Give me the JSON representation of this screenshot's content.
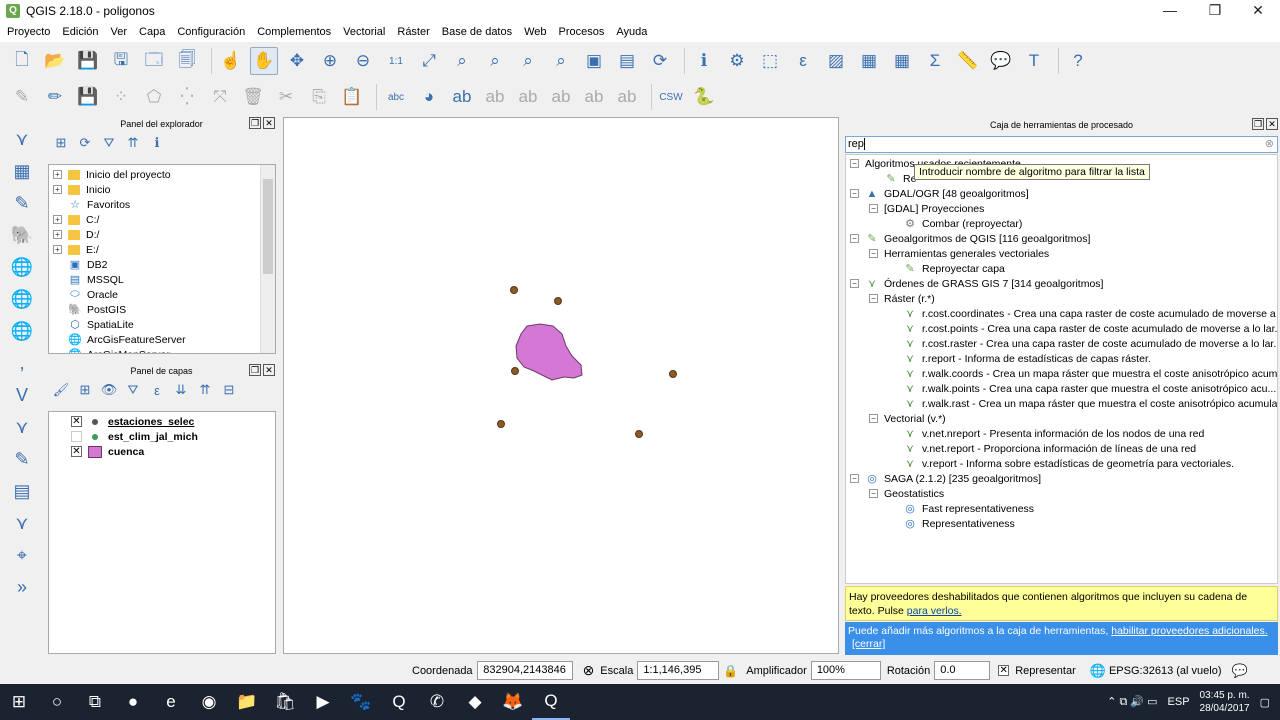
{
  "window": {
    "title": "QGIS 2.18.0 - poligonos",
    "icon": "qgis-icon",
    "minimize": "—",
    "maximize": "❐",
    "close": "✕"
  },
  "menu": [
    "Proyecto",
    "Edición",
    "Ver",
    "Capa",
    "Configuración",
    "Complementos",
    "Vectorial",
    "Ráster",
    "Base de datos",
    "Web",
    "Procesos",
    "Ayuda"
  ],
  "toolbar1": [
    {
      "name": "new-project-icon",
      "glyph": "🗋"
    },
    {
      "name": "open-project-icon",
      "glyph": "📂"
    },
    {
      "name": "save-project-icon",
      "glyph": "💾"
    },
    {
      "name": "save-as-icon",
      "glyph": "🖫"
    },
    {
      "name": "new-print-composer-icon",
      "glyph": "🗔"
    },
    {
      "name": "composer-manager-icon",
      "glyph": "🗐"
    },
    {
      "name": "sep"
    },
    {
      "name": "touch-zoom-icon",
      "glyph": "☝"
    },
    {
      "name": "pan-icon",
      "glyph": "✋",
      "active": true
    },
    {
      "name": "pan-to-selection-icon",
      "glyph": "✥"
    },
    {
      "name": "zoom-in-icon",
      "glyph": "⊕"
    },
    {
      "name": "zoom-out-icon",
      "glyph": "⊖"
    },
    {
      "name": "zoom-native-icon",
      "glyph": "1:1"
    },
    {
      "name": "zoom-full-icon",
      "glyph": "⤢"
    },
    {
      "name": "zoom-selection-icon",
      "glyph": "⌕"
    },
    {
      "name": "zoom-layer-icon",
      "glyph": "⌕"
    },
    {
      "name": "zoom-last-icon",
      "glyph": "⌕"
    },
    {
      "name": "zoom-next-icon",
      "glyph": "⌕"
    },
    {
      "name": "new-bookmark-icon",
      "glyph": "▣"
    },
    {
      "name": "show-bookmarks-icon",
      "glyph": "▤"
    },
    {
      "name": "refresh-icon",
      "glyph": "⟳"
    },
    {
      "name": "sep"
    },
    {
      "name": "identify-icon",
      "glyph": "ℹ"
    },
    {
      "name": "action-icon",
      "glyph": "⚙"
    },
    {
      "name": "select-features-icon",
      "glyph": "⬚"
    },
    {
      "name": "select-value-icon",
      "glyph": "ε"
    },
    {
      "name": "deselect-icon",
      "glyph": "▨"
    },
    {
      "name": "attribute-table-icon",
      "glyph": "▦"
    },
    {
      "name": "field-calculator-icon",
      "glyph": "▦"
    },
    {
      "name": "statistics-icon",
      "glyph": "Σ"
    },
    {
      "name": "measure-icon",
      "glyph": "📏"
    },
    {
      "name": "map-tips-icon",
      "glyph": "💬"
    },
    {
      "name": "text-annotation-icon",
      "glyph": "T"
    },
    {
      "name": "sep"
    },
    {
      "name": "help-icon",
      "glyph": "?"
    }
  ],
  "toolbar2": [
    {
      "name": "current-edits-icon",
      "glyph": "✎",
      "dim": true
    },
    {
      "name": "toggle-editing-icon",
      "glyph": "✏"
    },
    {
      "name": "save-edits-icon",
      "glyph": "💾",
      "dim": true
    },
    {
      "name": "add-feature-icon",
      "glyph": "⁘",
      "dim": true
    },
    {
      "name": "add-polygon-icon",
      "glyph": "⬠",
      "dim": true
    },
    {
      "name": "node-tool-icon",
      "glyph": "⁛",
      "dim": true
    },
    {
      "name": "move-feature-icon",
      "glyph": "⤧",
      "dim": true
    },
    {
      "name": "delete-selected-icon",
      "glyph": "🗑",
      "dim": true
    },
    {
      "name": "cut-features-icon",
      "glyph": "✂",
      "dim": true
    },
    {
      "name": "copy-features-icon",
      "glyph": "⎘",
      "dim": true
    },
    {
      "name": "paste-features-icon",
      "glyph": "📋",
      "dim": true
    },
    {
      "name": "sep"
    },
    {
      "name": "label-tool-icon",
      "glyph": "abc"
    },
    {
      "name": "diagram-icon",
      "glyph": "◕"
    },
    {
      "name": "highlight-labels-icon",
      "glyph": "ab"
    },
    {
      "name": "pin-labels-icon",
      "glyph": "ab",
      "dim": true
    },
    {
      "name": "show-hide-labels-icon",
      "glyph": "ab",
      "dim": true
    },
    {
      "name": "move-label-icon",
      "glyph": "ab",
      "dim": true
    },
    {
      "name": "rotate-label-icon",
      "glyph": "ab",
      "dim": true
    },
    {
      "name": "change-label-icon",
      "glyph": "ab",
      "dim": true
    },
    {
      "name": "sep"
    },
    {
      "name": "csw-icon",
      "glyph": "CSW"
    },
    {
      "name": "python-console-icon",
      "glyph": "🐍"
    }
  ],
  "lefttoolbar": [
    "add-vector-layer-icon",
    "add-raster-layer-icon",
    "add-spatialite-layer-icon",
    "add-postgis-layer-icon",
    "add-wms-layer-icon",
    "add-wcs-layer-icon",
    "add-wfs-layer-icon",
    "add-delimited-text-icon",
    "add-virtual-layer-icon",
    "new-shapefile-icon",
    "new-spatialite-icon",
    "new-geopackage-icon",
    "new-temp-layer-icon",
    "gps-icon",
    "more-icon"
  ],
  "browser": {
    "title": "Panel del explorador",
    "items": [
      {
        "label": "Inicio del proyecto",
        "icon": "folder"
      },
      {
        "label": "Inicio",
        "icon": "folder"
      },
      {
        "label": "Favoritos",
        "icon": "star"
      },
      {
        "label": "C:/",
        "icon": "folder"
      },
      {
        "label": "D:/",
        "icon": "folder"
      },
      {
        "label": "E:/",
        "icon": "folder"
      },
      {
        "label": "DB2",
        "icon": "db2"
      },
      {
        "label": "MSSQL",
        "icon": "mssql"
      },
      {
        "label": "Oracle",
        "icon": "oracle"
      },
      {
        "label": "PostGIS",
        "icon": "postgis"
      },
      {
        "label": "SpatiaLite",
        "icon": "spatialite"
      },
      {
        "label": "ArcGisFeatureServer",
        "icon": "arcgis"
      },
      {
        "label": "ArcGisMapServer",
        "icon": "arcgis"
      }
    ]
  },
  "layers": {
    "title": "Panel de capas",
    "items": [
      {
        "label": "estaciones_selec",
        "checked": true,
        "symbol": "point-dark",
        "bold": true,
        "underline": true
      },
      {
        "label": "est_clim_jal_mich",
        "checked": false,
        "symbol": "point-green",
        "bold": true
      },
      {
        "label": "cuenca",
        "checked": true,
        "symbol": "polygon-pink",
        "bold": true
      }
    ]
  },
  "processing": {
    "title": "Caja de herramientas de procesado",
    "search_value": "rep",
    "tooltip": "Introducir nombre de algoritmo para filtrar la lista",
    "tree": [
      {
        "level": 0,
        "label": "Algoritmos usados recientemente",
        "exp": "−",
        "icon": ""
      },
      {
        "level": 1,
        "label": "Re",
        "exp": "",
        "icon": "qgis-algorithm-icon"
      },
      {
        "level": 0,
        "label": "GDAL/OGR [48 geoalgoritmos]",
        "exp": "−",
        "icon": "gdal-icon"
      },
      {
        "level": 1,
        "label": "[GDAL] Proyecciones",
        "exp": "−",
        "icon": ""
      },
      {
        "level": 2,
        "label": "Combar (reproyectar)",
        "exp": "",
        "icon": "gdal-tool-icon"
      },
      {
        "level": 0,
        "label": "Geoalgoritmos de QGIS [116 geoalgoritmos]",
        "exp": "−",
        "icon": "qgis-algorithm-icon"
      },
      {
        "level": 1,
        "label": "Herramientas generales vectoriales",
        "exp": "−",
        "icon": ""
      },
      {
        "level": 2,
        "label": "Reproyectar capa",
        "exp": "",
        "icon": "qgis-algorithm-icon"
      },
      {
        "level": 0,
        "label": "Órdenes de GRASS GIS 7 [314 geoalgoritmos]",
        "exp": "−",
        "icon": "grass-icon"
      },
      {
        "level": 1,
        "label": "Ráster (r.*)",
        "exp": "−",
        "icon": ""
      },
      {
        "level": 2,
        "label": "r.cost.coordinates - Crea una capa raster de coste acumulado de moverse a ...",
        "exp": "",
        "icon": "grass-icon"
      },
      {
        "level": 2,
        "label": "r.cost.points - Crea una capa raster de coste acumulado de moverse a lo lar...",
        "exp": "",
        "icon": "grass-icon"
      },
      {
        "level": 2,
        "label": "r.cost.raster - Crea una capa raster de coste acumulado de moverse a lo lar...",
        "exp": "",
        "icon": "grass-icon"
      },
      {
        "level": 2,
        "label": "r.report - Informa de estadísticas de capas ráster.",
        "exp": "",
        "icon": "grass-icon"
      },
      {
        "level": 2,
        "label": "r.walk.coords - Crea un mapa ráster que muestra el coste anisotrópico acum...",
        "exp": "",
        "icon": "grass-icon"
      },
      {
        "level": 2,
        "label": "r.walk.points - Crea una capa raster que muestra el coste anisotrópico acu...",
        "exp": "",
        "icon": "grass-icon"
      },
      {
        "level": 2,
        "label": "r.walk.rast - Crea un mapa ráster que muestra el coste anisotrópico acumula...",
        "exp": "",
        "icon": "grass-icon"
      },
      {
        "level": 1,
        "label": "Vectorial (v.*)",
        "exp": "−",
        "icon": ""
      },
      {
        "level": 2,
        "label": "v.net.nreport - Presenta información de los nodos de una red",
        "exp": "",
        "icon": "grass-icon"
      },
      {
        "level": 2,
        "label": "v.net.report - Proporciona información de líneas de una red",
        "exp": "",
        "icon": "grass-icon"
      },
      {
        "level": 2,
        "label": "v.report - Informa sobre estadísticas de geometría para vectoriales.",
        "exp": "",
        "icon": "grass-icon"
      },
      {
        "level": 0,
        "label": "SAGA (2.1.2) [235 geoalgoritmos]",
        "exp": "−",
        "icon": "saga-icon"
      },
      {
        "level": 1,
        "label": "Geostatistics",
        "exp": "−",
        "icon": ""
      },
      {
        "level": 2,
        "label": "Fast representativeness",
        "exp": "",
        "icon": "saga-icon"
      },
      {
        "level": 2,
        "label": "Representativeness",
        "exp": "",
        "icon": "saga-icon"
      }
    ],
    "warn_text": "Hay proveedores deshabilitados que contienen algoritmos que incluyen su cadena de texto. Pulse ",
    "warn_link": "para verlos.",
    "info_text": "Puede añadir más algoritmos a la caja de herramientas, ",
    "info_link": "habilitar proveedores adicionales.",
    "info_close": "[cerrar]"
  },
  "status": {
    "coord_label": "Coordenada",
    "coord_value": "832904,2143846",
    "scale_label": "Escala",
    "scale_value": "1:1,146,395",
    "magnifier_label": "Amplificador",
    "magnifier_value": "100%",
    "rotation_label": "Rotación",
    "rotation_value": "0.0",
    "render_label": "Representar",
    "render_checked": true,
    "crs": "EPSG:32613 (al vuelo)"
  },
  "taskbar": {
    "lang": "ESP",
    "time": "03:45 p. m.",
    "date": "28/04/2017",
    "apps": [
      "start-icon",
      "cortana-icon",
      "task-view-icon",
      "spotify-icon",
      "edge-icon",
      "chrome-icon",
      "explorer-icon",
      "store-icon",
      "media-icon",
      "gimp-icon",
      "qgis-icon",
      "whatsapp-icon",
      "app-icon",
      "firefox-icon",
      "qgis-active-icon"
    ]
  }
}
